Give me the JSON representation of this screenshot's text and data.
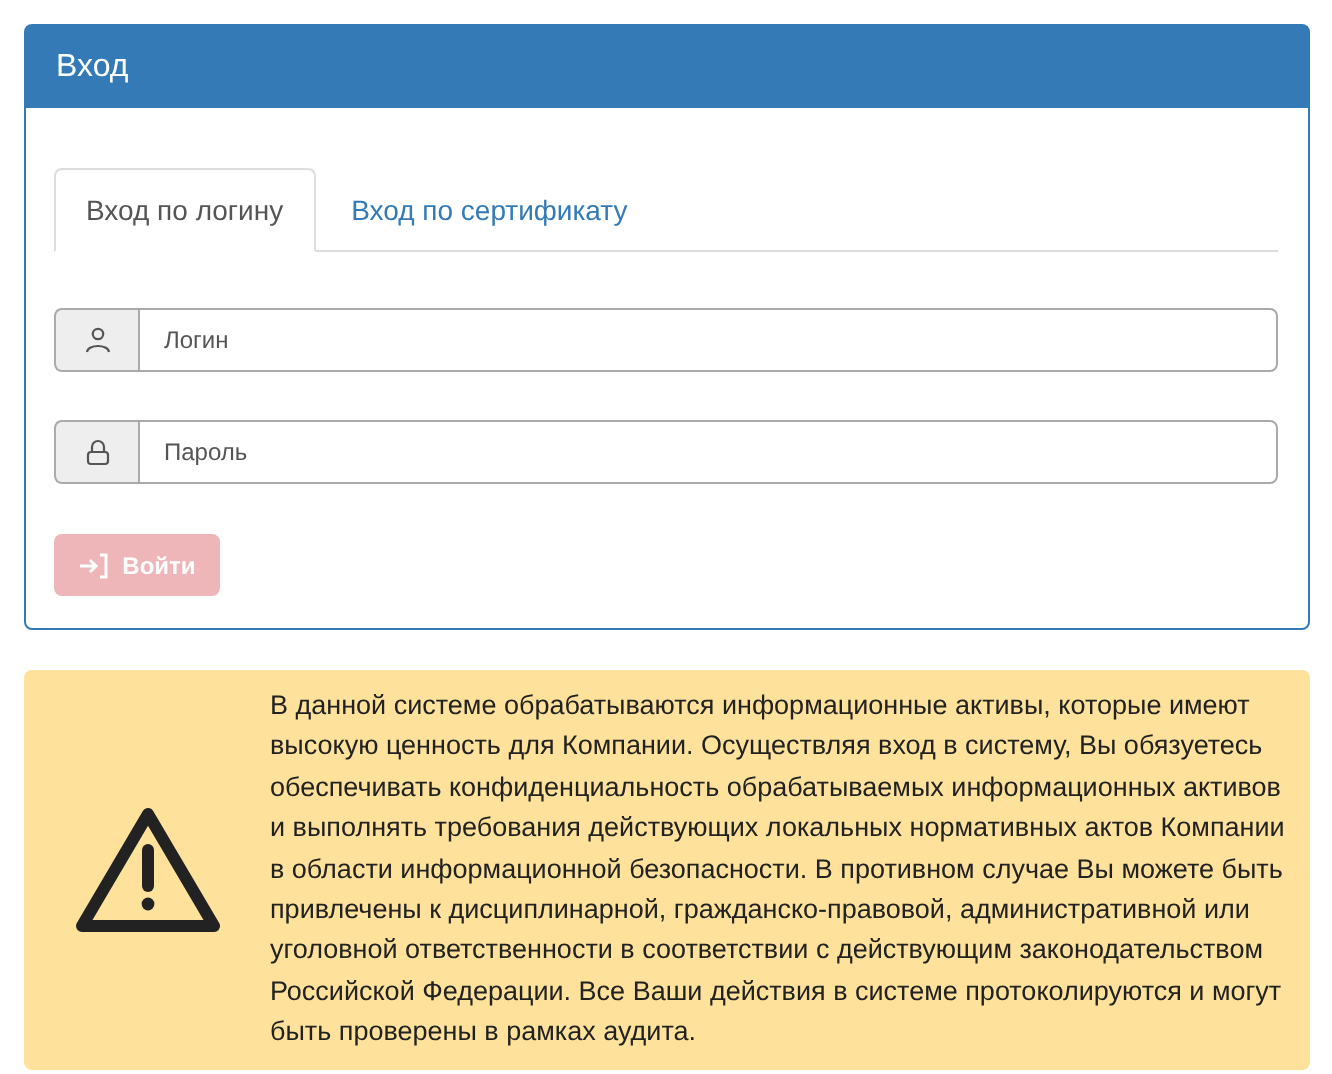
{
  "panel": {
    "title": "Вход"
  },
  "tabs": [
    {
      "label": "Вход по логину",
      "selected": true
    },
    {
      "label": "Вход по сертификату",
      "selected": false
    }
  ],
  "fields": [
    {
      "kind": "user",
      "placeholder": "Логин"
    },
    {
      "kind": "password",
      "placeholder": "Пароль"
    }
  ],
  "submit": {
    "label": "Войти",
    "disabled": true
  },
  "warning": {
    "text": "В данной системе обрабатываются информационные активы, которые имеют высокую ценность для Компании. Осуществляя вход в систему, Вы обязуетесь обеспечивать конфиденциальность обрабатываемых информационных активов и выполнять требования действующих локальных нормативных актов Компании в области информационной безопасности. В противном случае Вы можете быть привлечены к дисциплинарной, гражданско-правовой, административной или уголовной ответственности в соответствии с действующим законодательством Российской Федерации. Все Ваши действия в системе протоколируются и могут быть проверены в рамках аудита."
  }
}
